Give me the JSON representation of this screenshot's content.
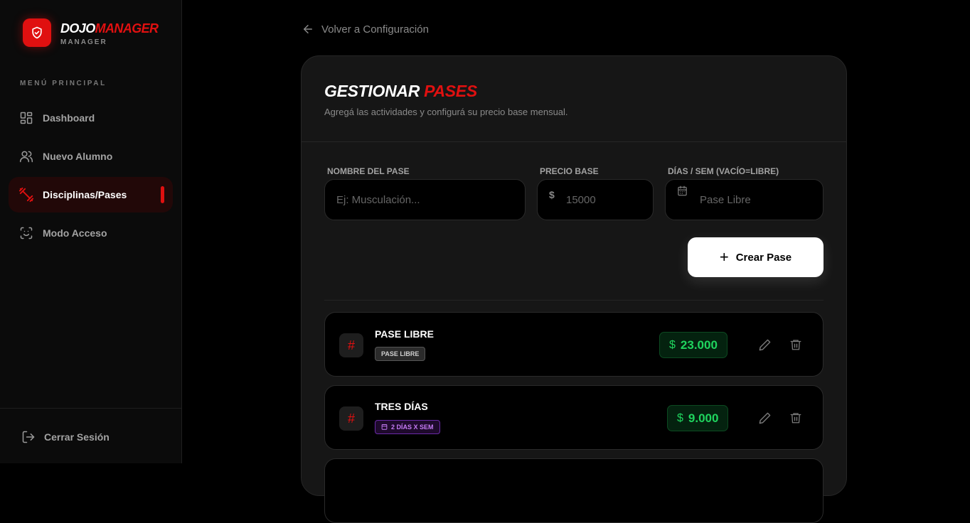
{
  "brand": {
    "name_part1": "DOJO",
    "name_part2": "MANAGER",
    "sub": "MANAGER"
  },
  "sidebar": {
    "menu_title": "MENÚ PRINCIPAL",
    "items": [
      {
        "label": "Dashboard",
        "icon": "dashboard-icon",
        "active": false
      },
      {
        "label": "Nuevo Alumno",
        "icon": "users-icon",
        "active": false
      },
      {
        "label": "Disciplinas/Pases",
        "icon": "dumbbell-icon",
        "active": true
      },
      {
        "label": "Modo Acceso",
        "icon": "face-scan-icon",
        "active": false
      }
    ],
    "logout_label": "Cerrar Sesión"
  },
  "back_link": "Volver a Configuración",
  "card": {
    "title_part1": "GESTIONAR ",
    "title_part2": "PASES",
    "subtitle": "Agregá las actividades y configurá su precio base mensual."
  },
  "form": {
    "name_label": "NOMBRE DEL PASE",
    "name_placeholder": "Ej: Musculación...",
    "price_label": "PRECIO BASE",
    "price_currency": "$",
    "price_placeholder": "15000",
    "days_label": "DÍAS / SEM (VACÍO=LIBRE)",
    "days_placeholder": "Pase Libre",
    "create_button": "Crear Pase"
  },
  "passes": [
    {
      "hash": "#",
      "name": "PASE LIBRE",
      "badge": "PASE LIBRE",
      "badge_type": "free",
      "currency": "$",
      "price": "23.000"
    },
    {
      "hash": "#",
      "name": "TRES DÍAS",
      "badge": "2 DÍAS X SEM",
      "badge_type": "days",
      "currency": "$",
      "price": "9.000"
    }
  ],
  "colors": {
    "accent": "#e01010",
    "price_green": "#1fd45e",
    "badge_purple": "#c67cf5"
  }
}
